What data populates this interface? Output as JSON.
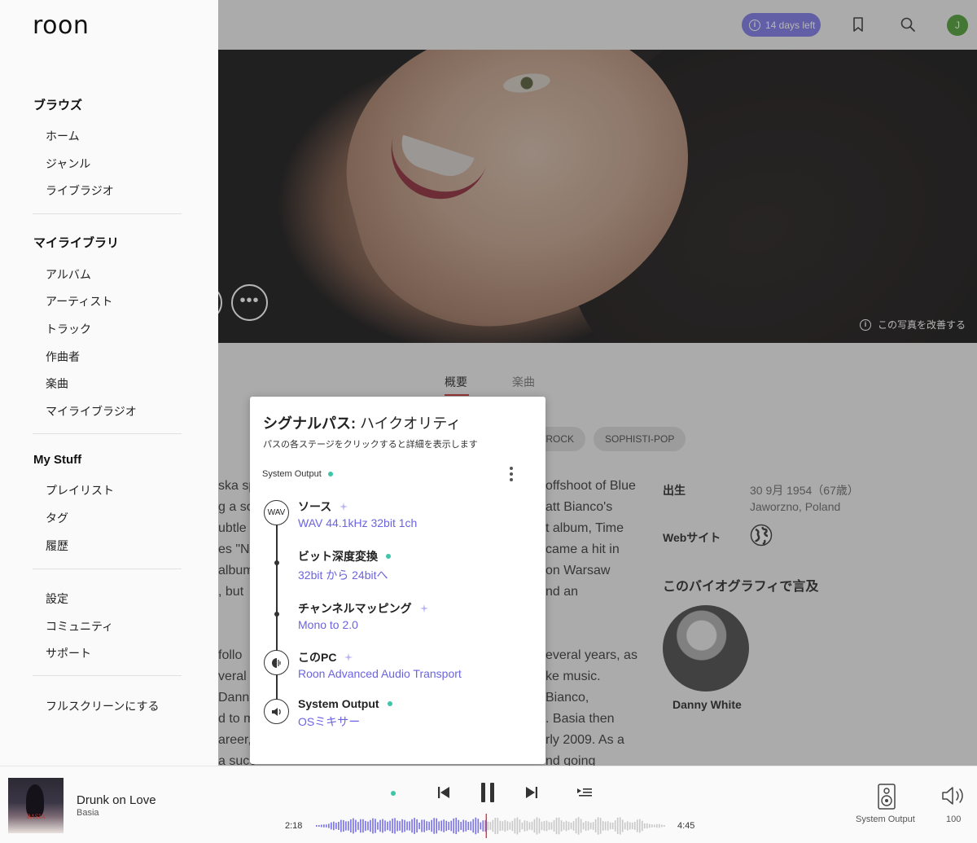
{
  "colors": {
    "accent": "#7a74e8",
    "link": "#6b64e0",
    "status_green": "#3ec6a8",
    "playhead": "#e0394f",
    "avatar": "#4a9a2f"
  },
  "app": {
    "logo": "roon"
  },
  "topbar": {
    "trial": "14 days left",
    "avatar_initial": "J",
    "icons": [
      "info-icon",
      "bookmark-icon",
      "search-icon"
    ]
  },
  "hero": {
    "improve_photo": "この写真を改善する"
  },
  "tabs": [
    {
      "label": "概要",
      "active": true
    },
    {
      "label": "楽曲",
      "active": false
    }
  ],
  "genres": [
    "/ROCK",
    "SOPHISTI-POP"
  ],
  "bio_left": [
    "ska sp",
    "g a so",
    "ubtle",
    "es \"N",
    "album",
    ", but",
    "",
    "",
    "follo",
    "veral",
    "Dann",
    "d to m",
    "areer,",
    "a succ"
  ],
  "bio_right": [
    "offshoot of Blue",
    "att Bianco's",
    "t album, Time",
    "came a hit in",
    "on Warsaw",
    "nd an",
    "",
    "",
    "everal years, as",
    "ke music.",
    "Bianco,",
    ". Basia then",
    "rly 2009. As a",
    "nd going"
  ],
  "meta": {
    "born_label": "出生",
    "born_date": "30 9月 1954（67歳）",
    "born_place": "Jaworzno, Poland",
    "web_label": "Webサイト"
  },
  "mentions": {
    "heading": "このバイオグラフィで言及",
    "name": "Danny White"
  },
  "sidebar": {
    "browse": {
      "heading": "ブラウズ",
      "items": [
        "ホーム",
        "ジャンル",
        "ライブラジオ"
      ]
    },
    "library": {
      "heading": "マイライブラリ",
      "items": [
        "アルバム",
        "アーティスト",
        "トラック",
        "作曲者",
        "楽曲",
        "マイライブラジオ"
      ]
    },
    "mystuff": {
      "heading": "My Stuff",
      "items": [
        "プレイリスト",
        "タグ",
        "履歴"
      ]
    },
    "misc": {
      "items": [
        "設定",
        "コミュニティ",
        "サポート"
      ]
    },
    "fullscreen": "フルスクリーンにする"
  },
  "signal_path": {
    "title_bold": "シグナルパス:",
    "title_quality": "ハイクオリティ",
    "subtitle": "パスの各ステージをクリックすると詳細を表示します",
    "zone": "System Output",
    "stages": [
      {
        "name": "ソース",
        "value": "WAV 44.1kHz 32bit 1ch",
        "node": "WAV",
        "indicator": "sparkle"
      },
      {
        "name": "ビット深度変換",
        "value": "32bit から 24bitへ",
        "indicator": "dot"
      },
      {
        "name": "チャンネルマッピング",
        "value": "Mono to 2.0",
        "indicator": "sparkle"
      },
      {
        "name": "このPC",
        "value": "Roon Advanced Audio Transport",
        "node_icon": "roon-transport-icon",
        "indicator": "sparkle"
      },
      {
        "name": "System Output",
        "value": "OSミキサー",
        "node_icon": "speaker-icon",
        "indicator": "dot"
      }
    ]
  },
  "player": {
    "track": "Drunk on Love",
    "artist": "Basia",
    "album_art_text": "BASIA",
    "elapsed": "2:18",
    "duration": "4:45",
    "progress": 0.485,
    "zone": "System Output",
    "volume": "100"
  }
}
